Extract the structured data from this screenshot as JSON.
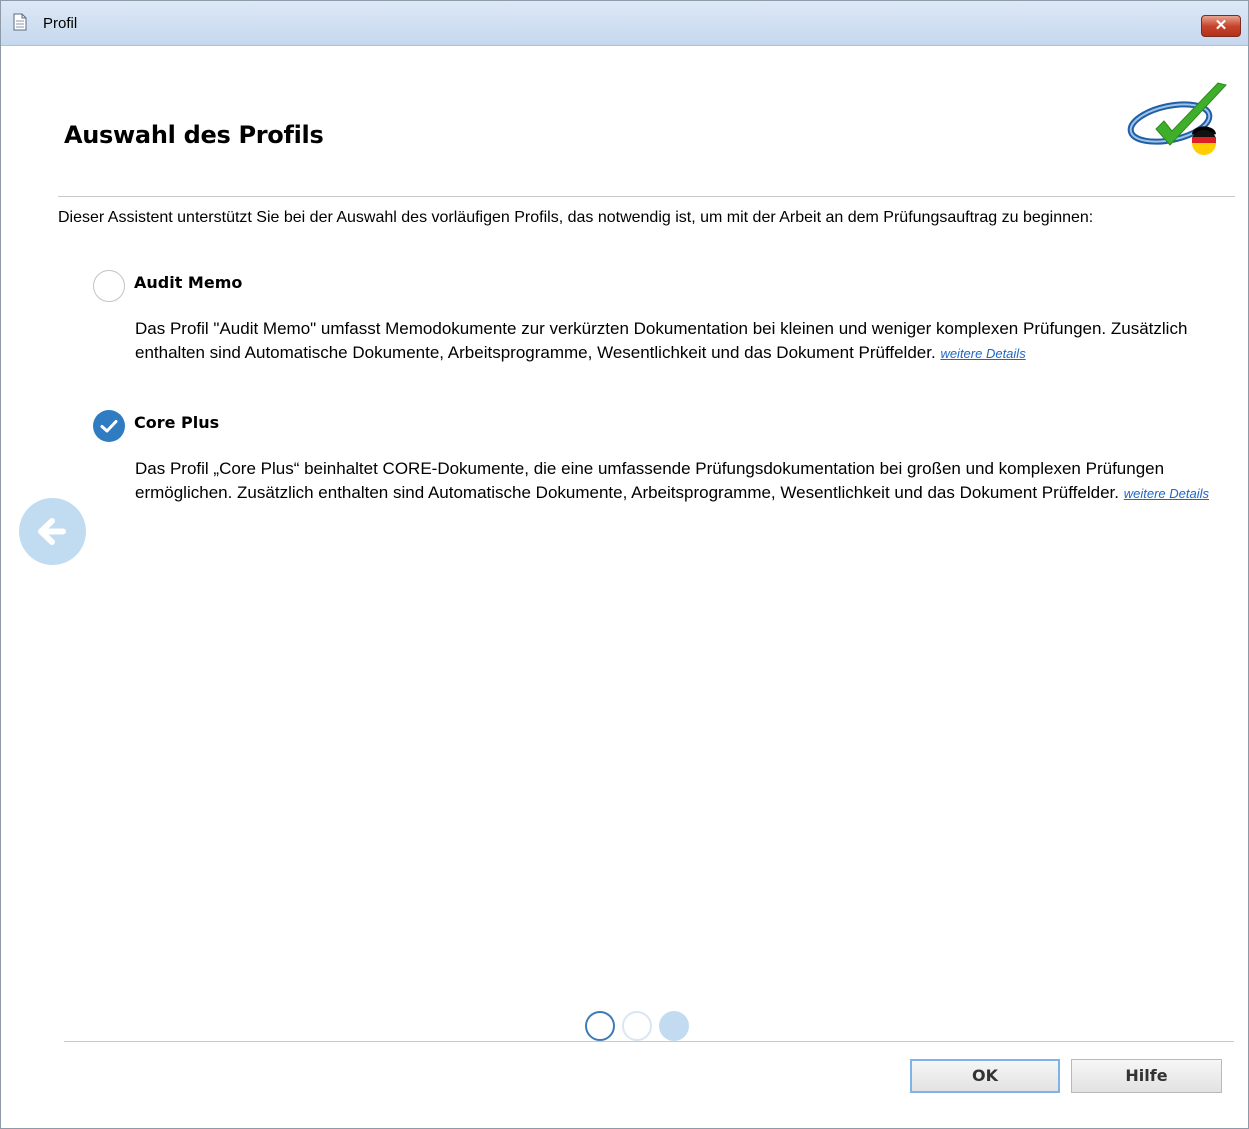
{
  "window": {
    "title": "Profil",
    "close_label": "✕"
  },
  "header": {
    "title": "Auswahl des Profils",
    "logo_icon": "checkmark-logo-with-german-flag"
  },
  "intro": "Dieser Assistent unterstützt Sie bei der Auswahl des vorläufigen Profils, das notwendig ist, um mit der Arbeit an dem Prüfungsauftrag zu beginnen:",
  "options": [
    {
      "title": "Audit Memo",
      "selected": false,
      "description": "Das Profil \"Audit Memo\" umfasst Memodokumente zur verkürzten Dokumentation bei kleinen und weniger komplexen Prüfungen. Zusätzlich enthalten sind Automatische Dokumente, Arbeitsprogramme, Wesentlichkeit und das Dokument Prüffelder.",
      "link": "weitere Details"
    },
    {
      "title": "Core Plus",
      "selected": true,
      "description": "Das Profil „Core Plus“ beinhaltet CORE-Dokumente, die eine umfassende Prüfungsdokumentation bei großen und komplexen Prüfungen ermöglichen. Zusätzlich enthalten sind Automatische Dokumente, Arbeitsprogramme, Wesentlichkeit und das Dokument Prüffelder.",
      "link": "weitere Details"
    }
  ],
  "navigation": {
    "back_icon": "arrow-left-icon",
    "steps_total": 3,
    "current_step": 1
  },
  "buttons": {
    "ok": "OK",
    "help": "Hilfe"
  },
  "colors": {
    "accent": "#2f7cc3",
    "link": "#1f67c4",
    "nav_light": "#c1dbf1"
  }
}
